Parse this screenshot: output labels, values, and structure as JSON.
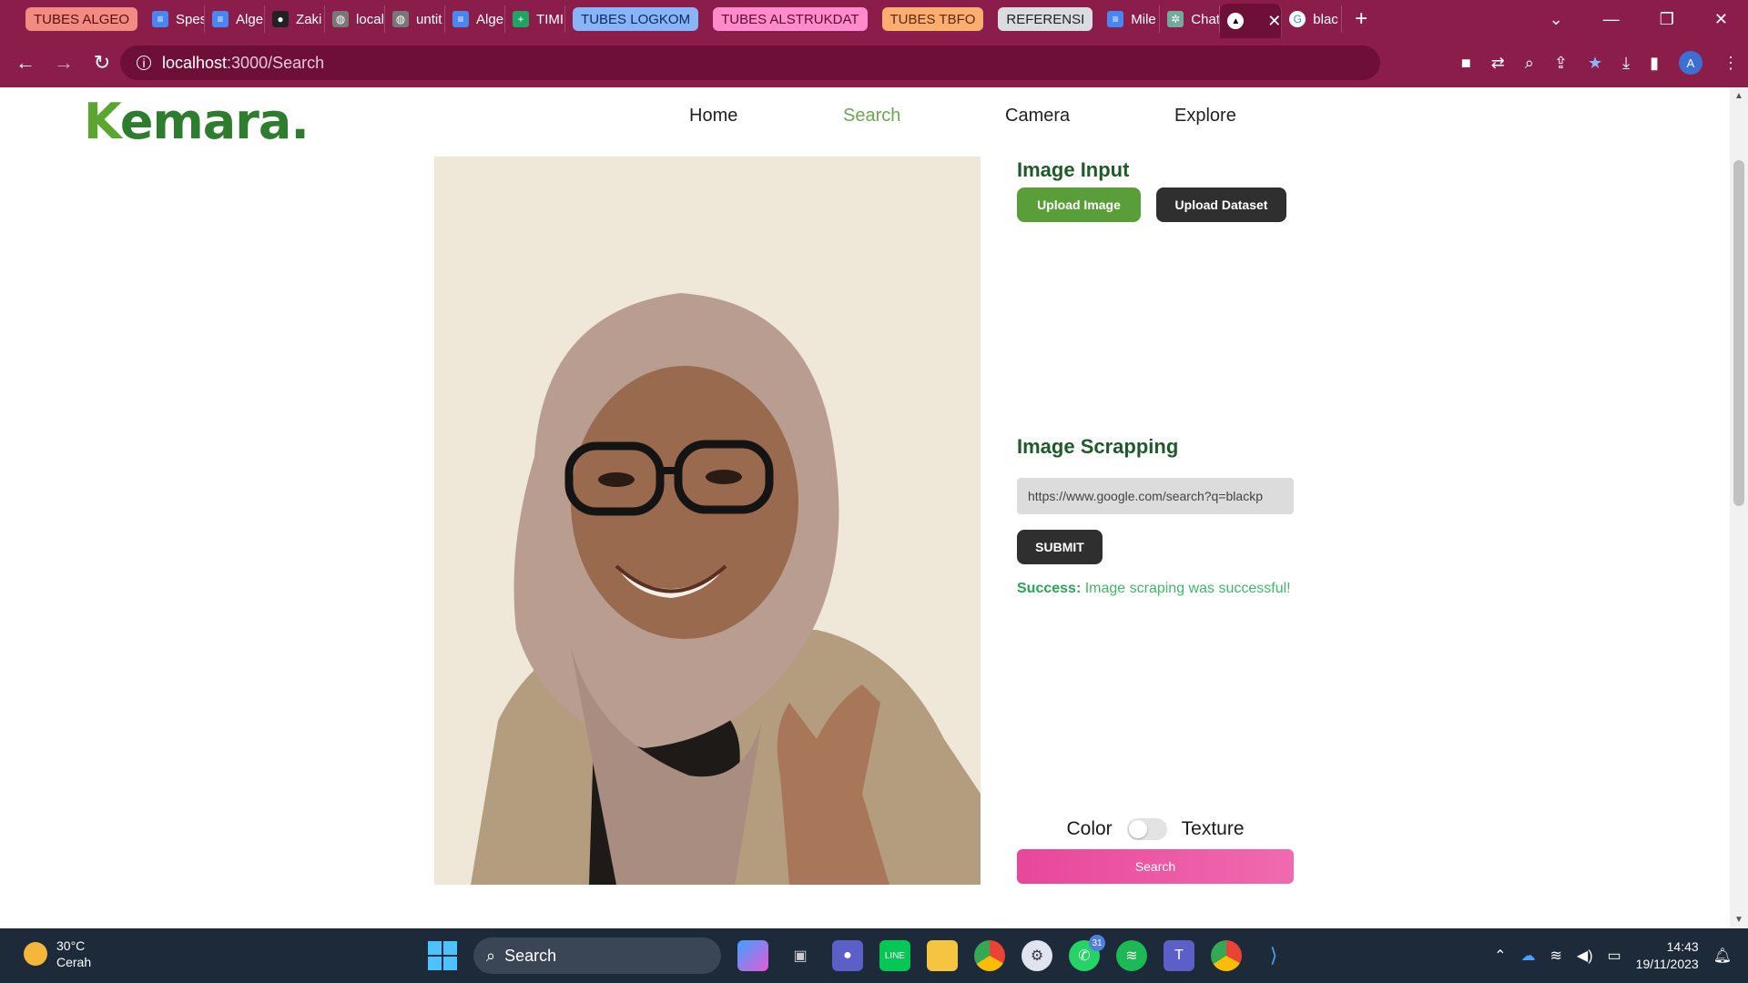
{
  "browser": {
    "tabs": [
      {
        "type": "group",
        "label": "TUBES ALGEO",
        "bg": "#f28b82",
        "fg": "#5a1010"
      },
      {
        "type": "tab",
        "label": "Spes",
        "icon": "doc-icon",
        "color": "#4a86f0"
      },
      {
        "type": "tab",
        "label": "Alge",
        "icon": "doc-icon",
        "color": "#4a86f0"
      },
      {
        "type": "tab",
        "label": "Zaki",
        "icon": "github-icon",
        "color": "#222222"
      },
      {
        "type": "tab",
        "label": "local",
        "icon": "globe-icon",
        "color": "#777777"
      },
      {
        "type": "tab",
        "label": "untit",
        "icon": "globe-icon",
        "color": "#777777"
      },
      {
        "type": "tab",
        "label": "Alge",
        "icon": "doc-icon",
        "color": "#4a86f0"
      },
      {
        "type": "tab",
        "label": "TIMI",
        "icon": "sheet-icon",
        "color": "#1fa463"
      },
      {
        "type": "group",
        "label": "TUBES LOGKOM",
        "bg": "#8ab4f8",
        "fg": "#0b2a5c"
      },
      {
        "type": "group",
        "label": "TUBES ALSTRUKDAT",
        "bg": "#ff8bcb",
        "fg": "#5a0c35"
      },
      {
        "type": "group",
        "label": "TUBES TBFO",
        "bg": "#fcad70",
        "fg": "#5a2a05"
      },
      {
        "type": "group",
        "label": "REFERENSI",
        "bg": "#dadce0",
        "fg": "#202124"
      },
      {
        "type": "tab",
        "label": "Mile",
        "icon": "doc-icon",
        "color": "#4a86f0"
      },
      {
        "type": "tab",
        "label": "Chat",
        "icon": "chatgpt-icon",
        "color": "#74aa9c"
      },
      {
        "type": "active",
        "label": "",
        "icon": "triangle-icon",
        "color": "#000000"
      },
      {
        "type": "tab",
        "label": "blac",
        "icon": "google-icon",
        "color": "#ffffff"
      }
    ],
    "url_host": "localhost",
    "url_path": ":3000/Search",
    "profile_initial": "A"
  },
  "site": {
    "logo_main": "emara",
    "logo_k": "K",
    "logo_dot": ".",
    "nav": [
      {
        "label": "Home",
        "active": false
      },
      {
        "label": "Search",
        "active": true
      },
      {
        "label": "Camera",
        "active": false
      },
      {
        "label": "Explore",
        "active": false
      }
    ]
  },
  "image_input": {
    "title": "Image Input",
    "upload_image": "Upload Image",
    "upload_dataset": "Upload Dataset"
  },
  "scraping": {
    "title": "Image Scrapping",
    "url_value": "https://www.google.com/search?q=blackp",
    "submit": "SUBMIT",
    "success_label": "Success:",
    "success_message": " Image scraping was successful!"
  },
  "mode": {
    "left": "Color",
    "right": "Texture",
    "texture_on": false
  },
  "search_button": "Search",
  "taskbar": {
    "temp": "30°C",
    "weather": "Cerah",
    "search": "Search",
    "whatsapp_badge": "31",
    "time": "14:43",
    "date": "19/11/2023"
  }
}
